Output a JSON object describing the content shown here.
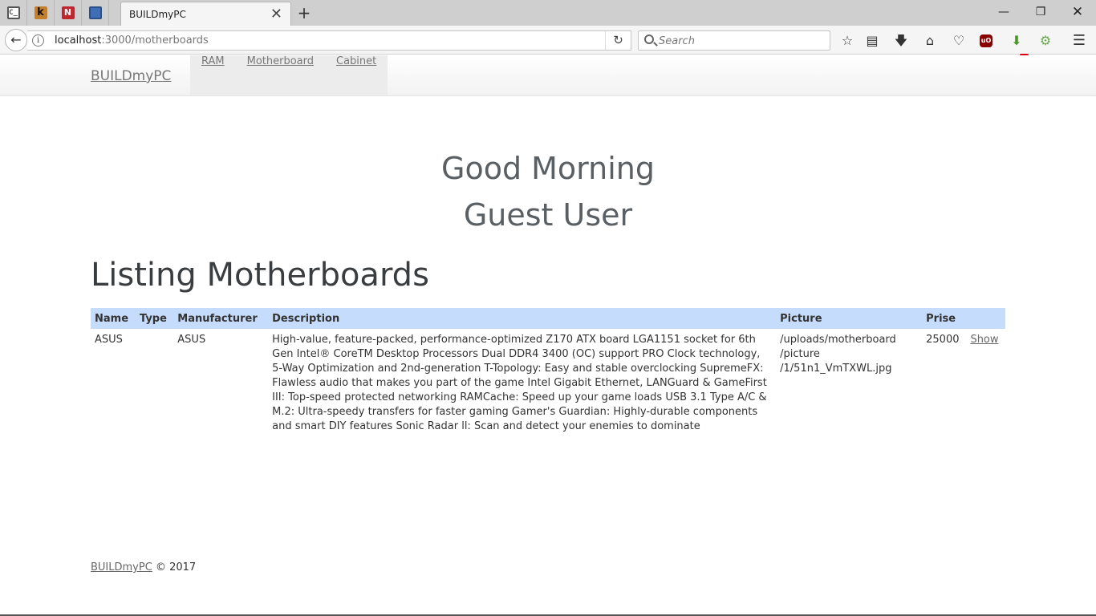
{
  "browser": {
    "active_tab_title": "BUILDmyPC",
    "tab_close": "✕",
    "new_tab": "+",
    "url_host": "localhost",
    "url_path": ":3000/motherboards",
    "search_placeholder": "Search",
    "download_badge": "?",
    "pinned_tabs": [
      {
        "icon": "terminal-icon",
        "glyph": "C_"
      },
      {
        "icon": "k-app-icon",
        "glyph": "k"
      },
      {
        "icon": "n-app-icon",
        "glyph": "N"
      },
      {
        "icon": "book-icon",
        "glyph": ""
      }
    ]
  },
  "site": {
    "brand": "BUILDmyPC",
    "nav": [
      "RAM",
      "Motherboard",
      "Cabinet"
    ],
    "greeting_line1": "Good Morning",
    "greeting_line2": "Guest User",
    "heading": "Listing Motherboards",
    "table": {
      "headers": [
        "Name",
        "Type",
        "Manufacturer",
        "Description",
        "Picture",
        "Prise",
        ""
      ],
      "rows": [
        {
          "name": "ASUS",
          "type": "",
          "manufacturer": "ASUS",
          "description": "High-value, feature-packed, performance-optimized Z170 ATX board LGA1151 socket for 6th Gen Intel® CoreTM Desktop Processors Dual DDR4 3400 (OC) support PRO Clock technology, 5-Way Optimization and 2nd-generation T-Topology: Easy and stable overclocking SupremeFX: Flawless audio that makes you part of the game Intel Gigabit Ethernet, LANGuard & GameFirst III: Top-speed protected networking RAMCache: Speed up your game loads USB 3.1 Type A/C & M.2: Ultra-speedy transfers for faster gaming Gamer's Guardian: Highly-durable components and smart DIY features Sonic Radar ll: Scan and detect your enemies to dominate",
          "picture": "/uploads/motherboard /picture /1/51n1_VmTXWL.jpg",
          "prise": "25000",
          "action": "Show"
        }
      ]
    },
    "footer_brand": "BUILDmyPC",
    "footer_copy": "© 2017"
  }
}
